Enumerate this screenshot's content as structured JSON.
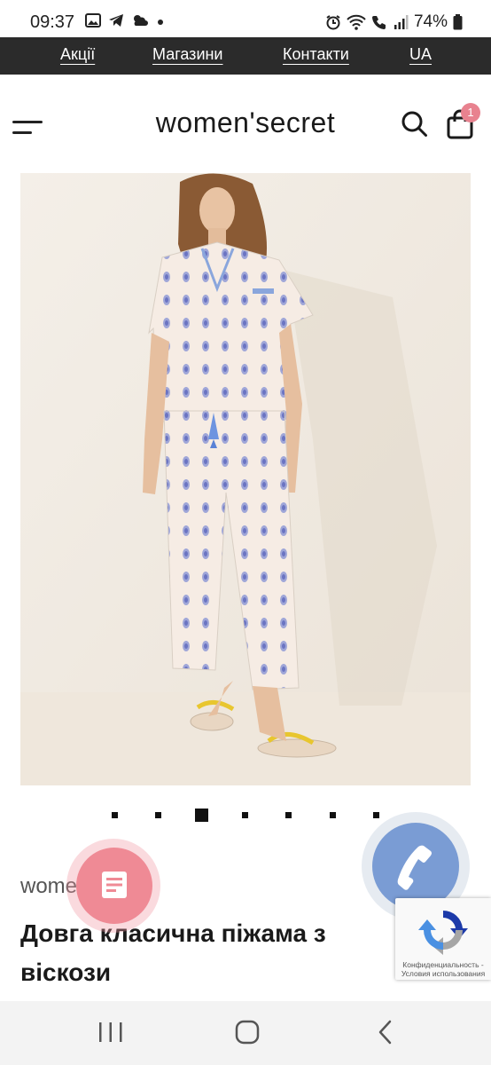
{
  "status_bar": {
    "time": "09:37",
    "battery": "74%",
    "icons": [
      "image-icon",
      "telegram-icon",
      "weather-icon",
      "dot-icon",
      "alarm-icon",
      "wifi-icon",
      "wifi-call-icon",
      "signal-icon",
      "battery-icon"
    ]
  },
  "top_nav": {
    "items": [
      "Акції",
      "Магазини",
      "Контакти",
      "UA"
    ]
  },
  "header": {
    "logo": "women'secret",
    "cart_count": "1"
  },
  "carousel": {
    "total": 7,
    "active_index": 2
  },
  "product": {
    "brand": "women'secret",
    "brand_visible_left": "wom",
    "brand_visible_right": "et",
    "title": "Довга класична піжама з віскози"
  },
  "recaptcha": {
    "line1": "Конфиденциальность -",
    "line2": "Условия использования"
  },
  "colors": {
    "topnav_bg": "#2b2b2b",
    "badge": "#e8828f",
    "fab_doc": "#ef8a95",
    "fab_phone": "#7a9cd4"
  }
}
